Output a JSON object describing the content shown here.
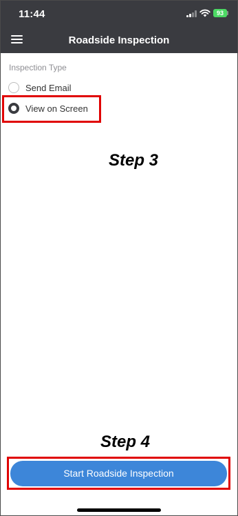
{
  "status_bar": {
    "time": "11:44",
    "battery": "93"
  },
  "nav": {
    "title": "Roadside Inspection"
  },
  "inspection": {
    "section_label": "Inspection Type",
    "options": [
      {
        "label": "Send Email",
        "selected": false
      },
      {
        "label": "View on Screen",
        "selected": true
      }
    ]
  },
  "annotations": {
    "step3": "Step 3",
    "step4": "Step 4"
  },
  "actions": {
    "start_label": "Start Roadside Inspection"
  },
  "colors": {
    "header": "#3a3b40",
    "primary_button": "#3d86d9",
    "highlight": "#e00000",
    "battery": "#4cd964"
  }
}
